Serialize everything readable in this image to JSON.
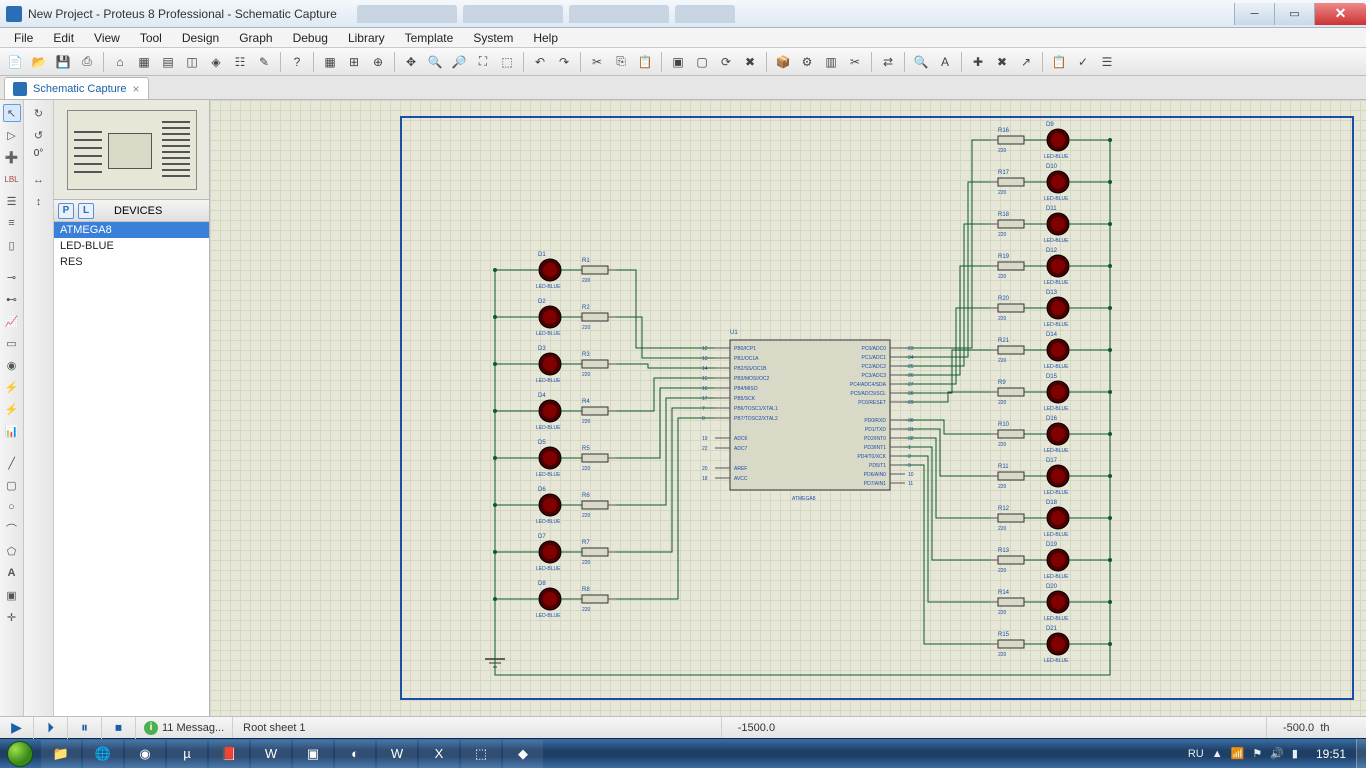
{
  "window": {
    "title": "New Project - Proteus 8 Professional - Schematic Capture"
  },
  "menu": {
    "items": [
      "File",
      "Edit",
      "View",
      "Tool",
      "Design",
      "Graph",
      "Debug",
      "Library",
      "Template",
      "System",
      "Help"
    ]
  },
  "doctab": {
    "label": "Schematic Capture",
    "close": "×"
  },
  "rotation": "0°",
  "devices": {
    "header": "DEVICES",
    "btnP": "P",
    "btnL": "L",
    "items": [
      "ATMEGA8",
      "LED-BLUE",
      "RES"
    ],
    "selected": 0
  },
  "sim": {
    "messages": "11 Messag...",
    "sheet": "Root sheet 1",
    "coordX": "-1500.0",
    "coordY": "-500.0",
    "unit": "th"
  },
  "tray": {
    "lang": "RU",
    "time": "19:51"
  },
  "ic": {
    "ref": "U1",
    "name": "ATMEGA8",
    "left_pins": [
      {
        "n": "12",
        "l": "PB0/ICP1"
      },
      {
        "n": "13",
        "l": "PB1/OC1A"
      },
      {
        "n": "14",
        "l": "PB2/SS/OC1B"
      },
      {
        "n": "15",
        "l": "PB3/MOSI/OC2"
      },
      {
        "n": "16",
        "l": "PB4/MISO"
      },
      {
        "n": "17",
        "l": "PB5/SCK"
      },
      {
        "n": "7",
        "l": "PB6/TOSC1/XTAL1"
      },
      {
        "n": "8",
        "l": "PB7/TOSC2/XTAL2"
      },
      {
        "n": "",
        "l": ""
      },
      {
        "n": "19",
        "l": "ADC6"
      },
      {
        "n": "22",
        "l": "ADC7"
      },
      {
        "n": "",
        "l": ""
      },
      {
        "n": "20",
        "l": "AREF"
      },
      {
        "n": "18",
        "l": "AVCC"
      }
    ],
    "right_pins": [
      {
        "n": "23",
        "l": "PC0/ADC0"
      },
      {
        "n": "24",
        "l": "PC1/ADC1"
      },
      {
        "n": "25",
        "l": "PC2/ADC2"
      },
      {
        "n": "26",
        "l": "PC3/ADC3"
      },
      {
        "n": "27",
        "l": "PC4/ADC4/SDA"
      },
      {
        "n": "28",
        "l": "PC5/ADC5/SCL"
      },
      {
        "n": "29",
        "l": "PC6/RESET"
      },
      {
        "n": "",
        "l": ""
      },
      {
        "n": "30",
        "l": "PD0/RXD"
      },
      {
        "n": "31",
        "l": "PD1/TXD"
      },
      {
        "n": "32",
        "l": "PD2/INT0"
      },
      {
        "n": "1",
        "l": "PD3/INT1"
      },
      {
        "n": "2",
        "l": "PD4/T0/XCK"
      },
      {
        "n": "9",
        "l": "PD5/T1"
      },
      {
        "n": "10",
        "l": "PD6/AIN0"
      },
      {
        "n": "11",
        "l": "PD7/AIN1"
      }
    ]
  },
  "leds_left": [
    {
      "d": "D1",
      "r": "R1"
    },
    {
      "d": "D2",
      "r": "R2"
    },
    {
      "d": "D3",
      "r": "R3"
    },
    {
      "d": "D4",
      "r": "R4"
    },
    {
      "d": "D5",
      "r": "R5"
    },
    {
      "d": "D6",
      "r": "R6"
    },
    {
      "d": "D7",
      "r": "R7"
    },
    {
      "d": "D8",
      "r": "R8"
    }
  ],
  "leds_right": [
    {
      "d": "D9",
      "r": "R16"
    },
    {
      "d": "D10",
      "r": "R17"
    },
    {
      "d": "D11",
      "r": "R18"
    },
    {
      "d": "D12",
      "r": "R19"
    },
    {
      "d": "D13",
      "r": "R20"
    },
    {
      "d": "D14",
      "r": "R21"
    },
    {
      "d": "D15",
      "r": "R9"
    },
    {
      "d": "D16",
      "r": "R10"
    },
    {
      "d": "D17",
      "r": "R11"
    },
    {
      "d": "D18",
      "r": "R12"
    },
    {
      "d": "D19",
      "r": "R13"
    },
    {
      "d": "D20",
      "r": "R14"
    },
    {
      "d": "D21",
      "r": "R15"
    }
  ],
  "res_val": "220",
  "led_type": "LED-BLUE"
}
